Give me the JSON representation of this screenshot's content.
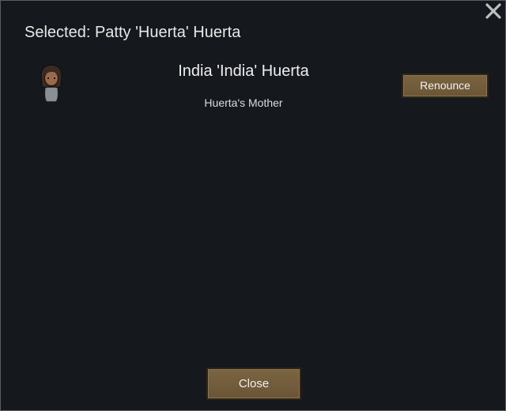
{
  "dialog": {
    "title": "Selected: Patty 'Huerta' Huerta",
    "close_label": "Close",
    "close_icon": "close-x-icon"
  },
  "relations": [
    {
      "name": "India 'India' Huerta",
      "role": "Huerta's Mother",
      "action_label": "Renounce",
      "portrait_icon": "pawn-portrait-icon"
    }
  ],
  "colors": {
    "background": "#15181d",
    "button": "#6e5939",
    "text": "#e6e6e6"
  }
}
